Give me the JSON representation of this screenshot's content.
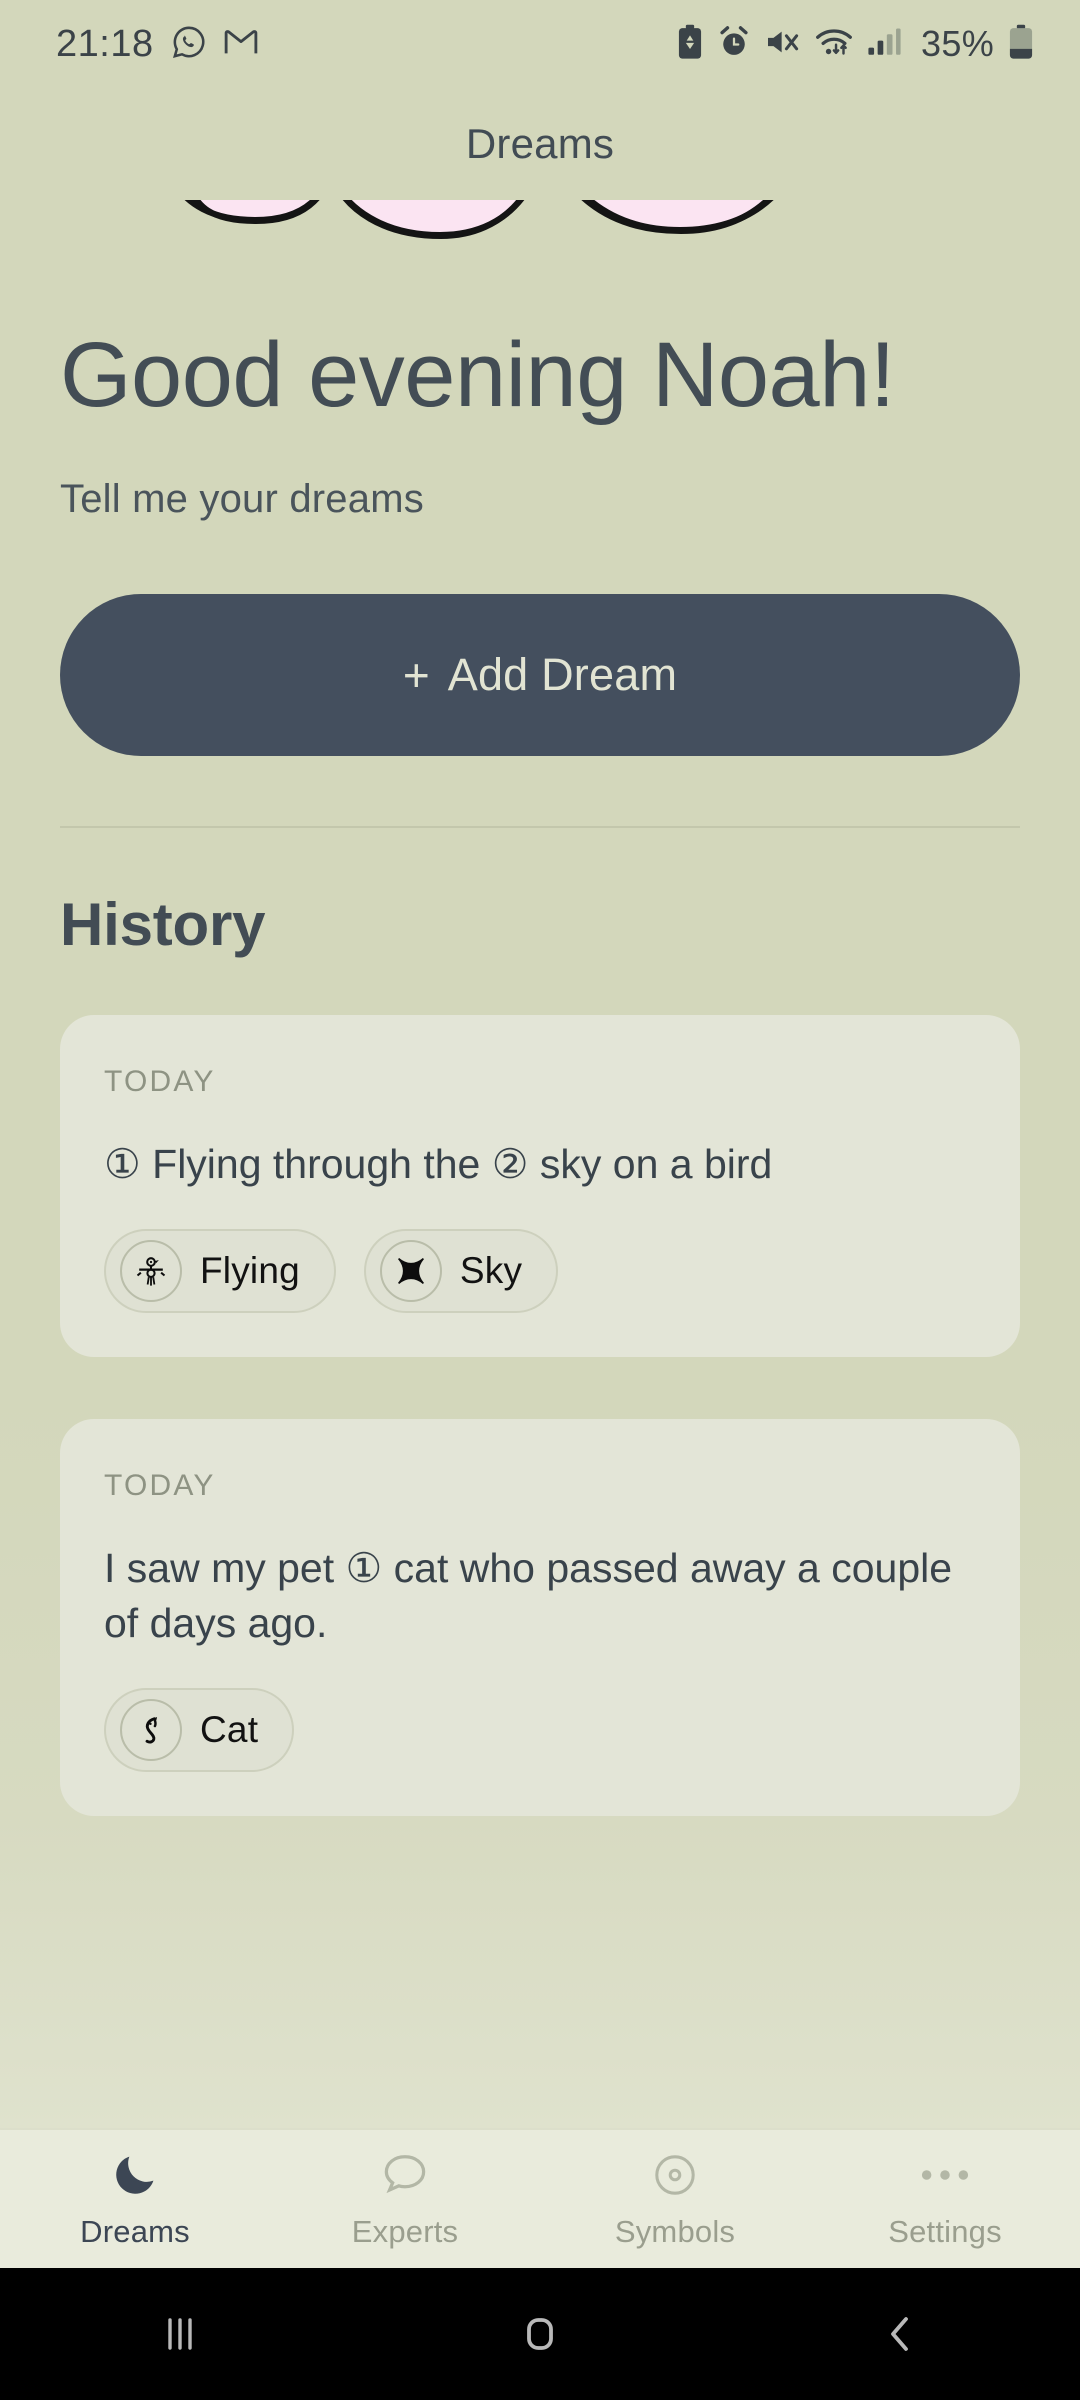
{
  "status_bar": {
    "time": "21:18",
    "battery_percent": "35%",
    "left_icons": [
      "whatsapp-icon",
      "gmail-icon"
    ],
    "right_icons": [
      "battery-saver-icon",
      "alarm-icon",
      "mute-icon",
      "wifi-icon",
      "signal-icon",
      "battery-icon"
    ]
  },
  "app": {
    "title": "Dreams",
    "accent_dark": "#444f5e",
    "page_bg": "#d3d7bb",
    "card_bg": "#e3e5d7",
    "cloud_fill": "#fbe4f2"
  },
  "home": {
    "greeting": "Good evening Noah!",
    "subtitle": "Tell me your dreams",
    "add_button": {
      "plus": "+",
      "label": "Add Dream"
    },
    "history_heading": "History"
  },
  "history": [
    {
      "day": "TODAY",
      "text": "① Flying through the ② sky on a bird",
      "chips": [
        {
          "label": "Flying",
          "icon": "bird-symbol-icon"
        },
        {
          "label": "Sky",
          "icon": "star-burst-symbol-icon"
        }
      ]
    },
    {
      "day": "TODAY",
      "text": "I saw my pet ① cat who passed away a couple of days ago.",
      "chips": [
        {
          "label": "Cat",
          "icon": "cat-symbol-icon"
        }
      ]
    }
  ],
  "tabs": [
    {
      "label": "Dreams",
      "icon": "moon-icon",
      "active": true
    },
    {
      "label": "Experts",
      "icon": "chat-bubble-icon",
      "active": false
    },
    {
      "label": "Symbols",
      "icon": "circle-target-icon",
      "active": false
    },
    {
      "label": "Settings",
      "icon": "three-dots-icon",
      "active": false
    }
  ],
  "system_nav": {
    "recents": "recents-icon",
    "home": "home-icon",
    "back": "back-icon"
  }
}
